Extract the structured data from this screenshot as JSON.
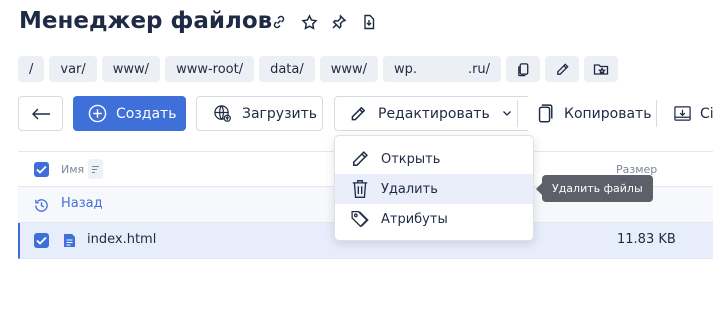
{
  "page": {
    "title": "Менеджер файлов"
  },
  "breadcrumb": {
    "segments": [
      "/",
      "var/",
      "www/",
      "www-root/",
      "data/",
      "www/"
    ],
    "wp_prefix": "wp.",
    "wp_suffix": ".ru/"
  },
  "toolbar": {
    "create_label": "Создать",
    "upload_label": "Загрузить",
    "edit_label": "Редактировать",
    "copy_label": "Копировать",
    "cut_label": "Сі"
  },
  "table": {
    "col_name": "Имя",
    "col_size": "Размер",
    "back_label": "Назад",
    "files": [
      {
        "name": "index.html",
        "size": "11.83 KB",
        "selected": true
      }
    ]
  },
  "edit_menu": {
    "items": [
      {
        "label": "Открыть",
        "icon": "pencil-icon"
      },
      {
        "label": "Удалить",
        "icon": "trash-icon"
      },
      {
        "label": "Атрибуты",
        "icon": "tags-icon"
      }
    ]
  },
  "tooltip": {
    "text": "Удалить файлы"
  },
  "colors": {
    "accent": "#3f6fd8",
    "text": "#1f2a44",
    "muted": "#7d879c",
    "tooltip_bg": "#5d6068"
  }
}
